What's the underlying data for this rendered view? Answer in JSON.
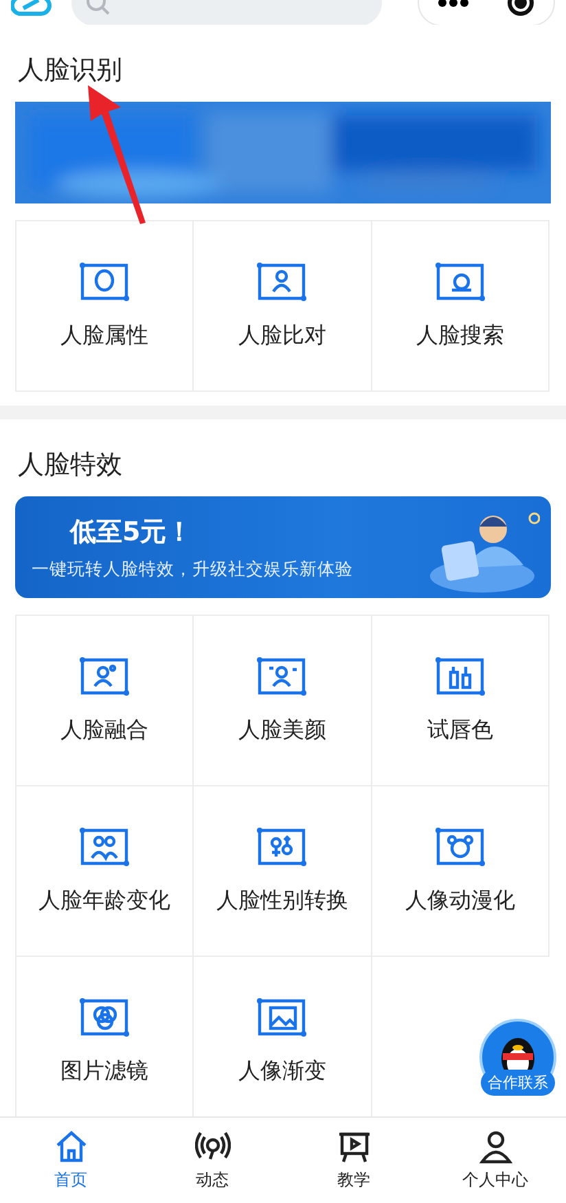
{
  "header": {
    "search": {
      "kind": "field"
    }
  },
  "sections": [
    {
      "title": "人脸识别",
      "banner": {
        "kind": "picture"
      },
      "items": [
        {
          "label": "人脸属性"
        },
        {
          "label": "人脸比对"
        },
        {
          "label": "人脸搜索"
        }
      ]
    },
    {
      "title": "人脸特效",
      "banner": {
        "kind": "promo",
        "headline": "低至5元！",
        "subtitle": "一键玩转人脸特效，升级社交娱乐新体验"
      },
      "items": [
        {
          "label": "人脸融合"
        },
        {
          "label": "人脸美颜"
        },
        {
          "label": "试唇色"
        },
        {
          "label": "人脸年龄变化"
        },
        {
          "label": "人脸性别转换"
        },
        {
          "label": "人像动漫化"
        },
        {
          "label": "图片滤镜"
        },
        {
          "label": "人像渐变"
        }
      ]
    }
  ],
  "contact_button": {
    "label": "合作联系"
  },
  "bottom_nav": [
    {
      "label": "首页",
      "selected": true
    },
    {
      "label": "动态",
      "selected": false
    },
    {
      "label": "教学",
      "selected": false
    },
    {
      "label": "个人中心",
      "selected": false
    }
  ]
}
